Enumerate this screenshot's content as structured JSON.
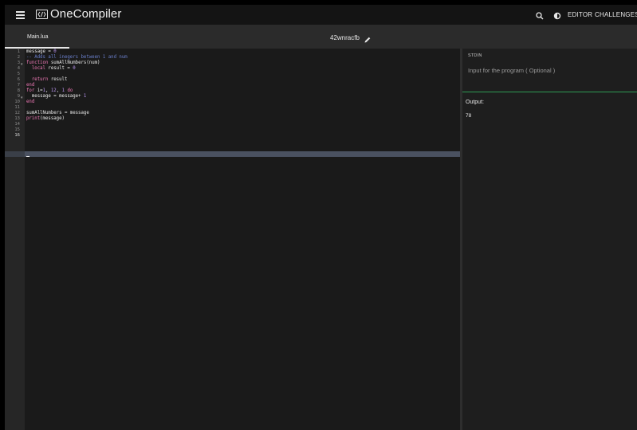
{
  "app": {
    "logo_text": "OneCompiler",
    "nav": {
      "editor": "EDITOR",
      "challenges": "CHALLENGES"
    }
  },
  "tab": {
    "label": "Main.lua"
  },
  "file": {
    "name": "42wnracfb"
  },
  "editor": {
    "line_numbers": [
      "1",
      "2",
      "3",
      "4",
      "5",
      "6",
      "7",
      "8",
      "9",
      "10",
      "11",
      "12",
      "13",
      "14",
      "15",
      "16"
    ],
    "active_line": 16
  },
  "stdin": {
    "label": "STDIN",
    "placeholder": "Input for the program ( Optional )"
  },
  "output": {
    "label": "Output:",
    "text": "78"
  },
  "colors": {
    "keyword": "#f17ab8",
    "comment": "#6a7fcb",
    "number": "#b995f0",
    "accent_green": "#2e9b54"
  }
}
